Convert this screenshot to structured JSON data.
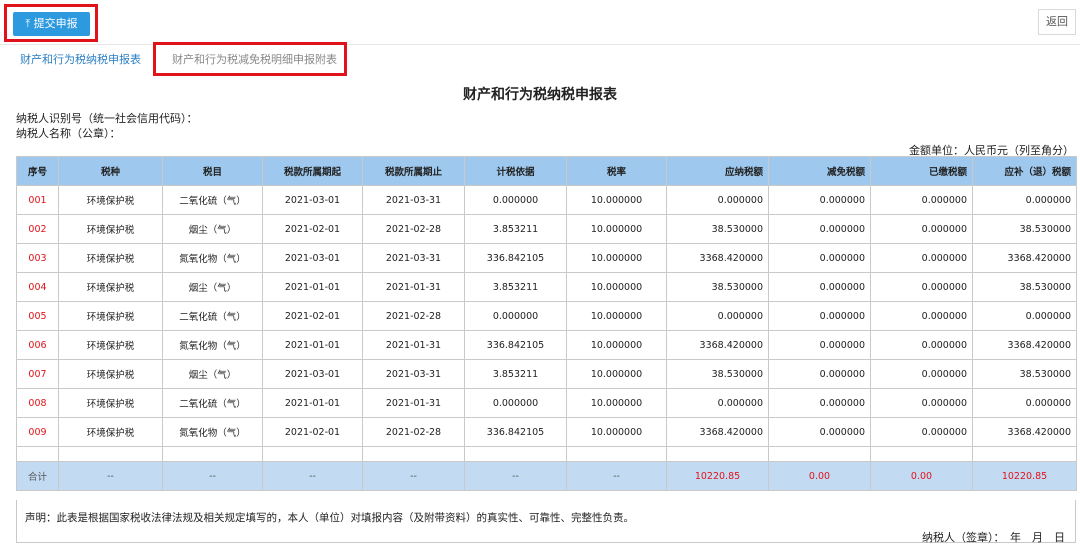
{
  "toolbar": {
    "submit_label": "提交申报",
    "return_label": "返回"
  },
  "tabs": [
    {
      "label": "财产和行为税纳税申报表"
    },
    {
      "label": "财产和行为税减免税明细申报附表"
    }
  ],
  "form": {
    "title": "财产和行为税纳税申报表",
    "taxpayer_id_label": "纳税人识别号（统一社会信用代码）：",
    "taxpayer_name_label": "纳税人名称（公章）：",
    "unit_label": "金额单位：人民币元（列至角分）"
  },
  "table": {
    "headers": [
      "序号",
      "税种",
      "税目",
      "税款所属期起",
      "税款所属期止",
      "计税依据",
      "税率",
      "应纳税额",
      "减免税额",
      "已缴税额",
      "应补（退）税额"
    ],
    "rows": [
      [
        "001",
        "环境保护税",
        "二氧化硫（气）",
        "2021-03-01",
        "2021-03-31",
        "0.000000",
        "10.000000",
        "0.000000",
        "0.000000",
        "0.000000",
        "0.000000"
      ],
      [
        "002",
        "环境保护税",
        "烟尘（气）",
        "2021-02-01",
        "2021-02-28",
        "3.853211",
        "10.000000",
        "38.530000",
        "0.000000",
        "0.000000",
        "38.530000"
      ],
      [
        "003",
        "环境保护税",
        "氮氧化物（气）",
        "2021-03-01",
        "2021-03-31",
        "336.842105",
        "10.000000",
        "3368.420000",
        "0.000000",
        "0.000000",
        "3368.420000"
      ],
      [
        "004",
        "环境保护税",
        "烟尘（气）",
        "2021-01-01",
        "2021-01-31",
        "3.853211",
        "10.000000",
        "38.530000",
        "0.000000",
        "0.000000",
        "38.530000"
      ],
      [
        "005",
        "环境保护税",
        "二氧化硫（气）",
        "2021-02-01",
        "2021-02-28",
        "0.000000",
        "10.000000",
        "0.000000",
        "0.000000",
        "0.000000",
        "0.000000"
      ],
      [
        "006",
        "环境保护税",
        "氮氧化物（气）",
        "2021-01-01",
        "2021-01-31",
        "336.842105",
        "10.000000",
        "3368.420000",
        "0.000000",
        "0.000000",
        "3368.420000"
      ],
      [
        "007",
        "环境保护税",
        "烟尘（气）",
        "2021-03-01",
        "2021-03-31",
        "3.853211",
        "10.000000",
        "38.530000",
        "0.000000",
        "0.000000",
        "38.530000"
      ],
      [
        "008",
        "环境保护税",
        "二氧化硫（气）",
        "2021-01-01",
        "2021-01-31",
        "0.000000",
        "10.000000",
        "0.000000",
        "0.000000",
        "0.000000",
        "0.000000"
      ],
      [
        "009",
        "环境保护税",
        "氮氧化物（气）",
        "2021-02-01",
        "2021-02-28",
        "336.842105",
        "10.000000",
        "3368.420000",
        "0.000000",
        "0.000000",
        "3368.420000"
      ]
    ],
    "total": [
      "合计",
      "--",
      "--",
      "--",
      "--",
      "--",
      "--",
      "10220.85",
      "0.00",
      "0.00",
      "10220.85"
    ]
  },
  "statement": {
    "text": "声明：此表是根据国家税收法律法规及相关规定填写的，本人（单位）对填报内容（及附带资料）的真实性、可靠性、完整性负责。",
    "sign_label": "纳税人（签章）：　年　月　日"
  },
  "colors": {
    "accent": "#2d9ae0",
    "highlight": "#e1131a",
    "header_bg": "#9ec8ee"
  }
}
